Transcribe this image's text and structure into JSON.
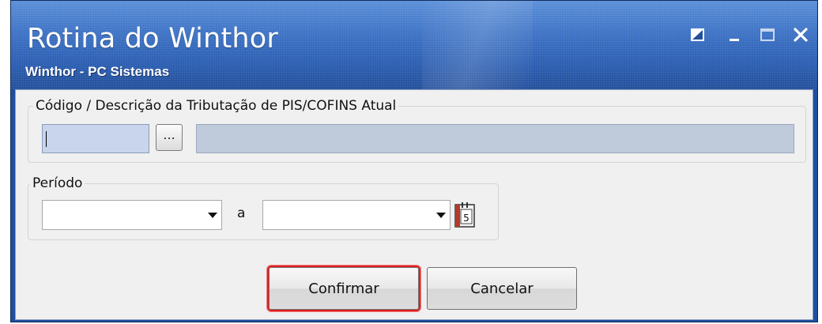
{
  "window": {
    "title": "Rotina do Winthor",
    "subtitle": "Winthor - PC Sistemas",
    "controls": [
      "restore-icon",
      "minimize-icon",
      "maximize-icon",
      "close-icon"
    ]
  },
  "tributacao": {
    "label": "Código / Descrição da Tributação de PIS/COFINS Atual",
    "code_value": "",
    "description_value": "",
    "lookup_button_label": "..."
  },
  "periodo": {
    "label": "Período",
    "start_value": "",
    "separator": "a",
    "end_value": "",
    "calendar_icon": "calendar-icon"
  },
  "actions": {
    "confirm_label": "Confirmar",
    "cancel_label": "Cancelar"
  },
  "colors": {
    "titlebar": "#3f74c6",
    "highlight": "#e02020",
    "input_focus": "#c9d5ed",
    "readonly_field": "#bfcbdb"
  }
}
